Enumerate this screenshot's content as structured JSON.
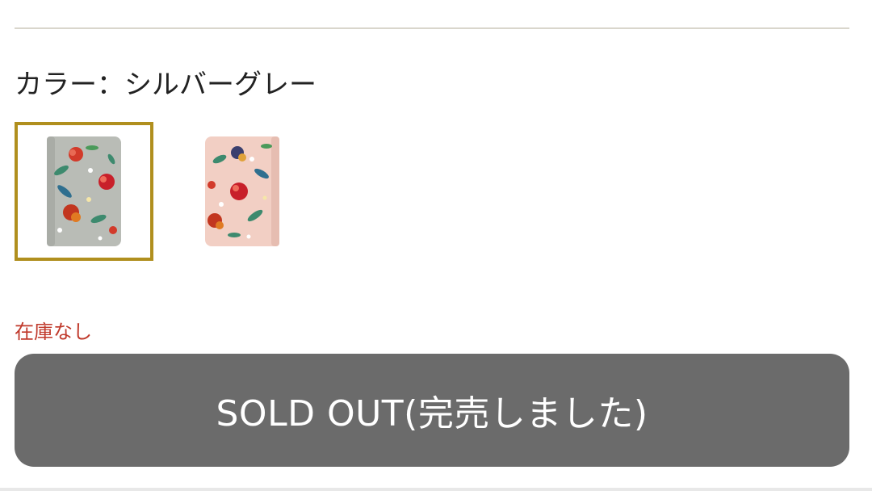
{
  "product": {
    "color_label": "カラー：シルバーグレー",
    "stock_status": "在庫なし",
    "sold_out_label": "SOLD OUT(完売しました)"
  },
  "swatches": [
    {
      "selected": true,
      "base_color": "#b9bcb6"
    },
    {
      "selected": false,
      "base_color": "#f2cfc4"
    }
  ],
  "colors": {
    "accent_border": "#b08f1e",
    "stock_text": "#c0392b",
    "sold_out_button": "#6b6b6b"
  }
}
